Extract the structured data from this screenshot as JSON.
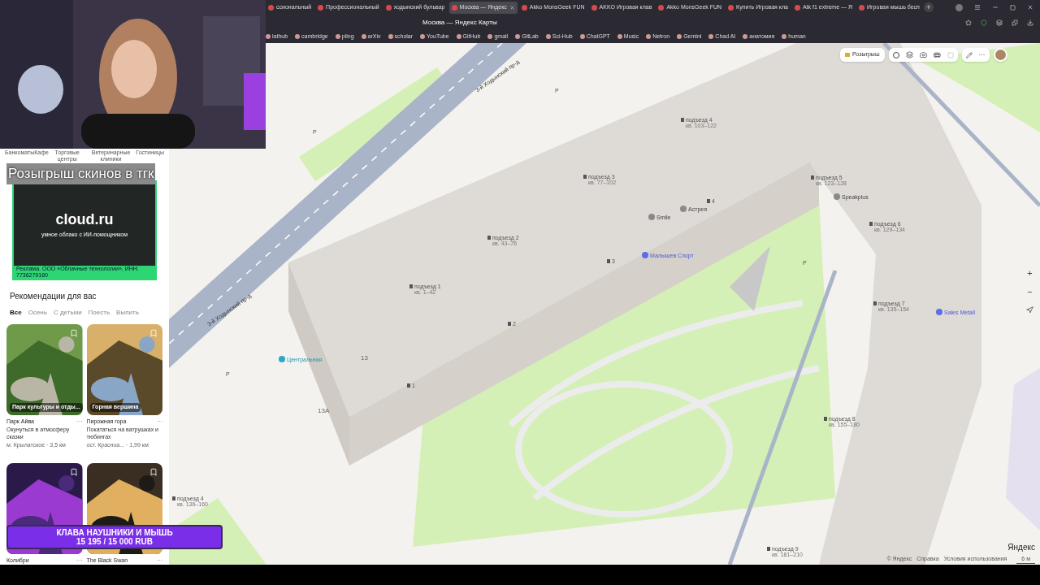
{
  "browser": {
    "tabs": [
      {
        "label": "ссиональный",
        "selected": false
      },
      {
        "label": "Профессиональный",
        "selected": false
      },
      {
        "label": "ходынский бульвар",
        "selected": false
      },
      {
        "label": "Москва — Яндекс",
        "selected": true
      },
      {
        "label": "Akko MonsGeek FUN",
        "selected": false
      },
      {
        "label": "AKKO Игровая клав",
        "selected": false
      },
      {
        "label": "Akko MonsGeek FUN",
        "selected": false
      },
      {
        "label": "Купить Игровая кла",
        "selected": false
      },
      {
        "label": "Atk f1 extreme — Я",
        "selected": false
      },
      {
        "label": "Игровая мышь бесп",
        "selected": false
      }
    ],
    "new_tab": "+",
    "page_title": "Москва — Яндекс Карты",
    "bookmarks": [
      "lathub",
      "cambridge",
      "pling",
      "arXiv",
      "scholar",
      "YouTube",
      "GitHub",
      "gmail",
      "GitLab",
      "Sci-Hub",
      "ChatGPT",
      "Music",
      "Netron",
      "Gemini",
      "Chad AI",
      "анатомия",
      "human"
    ]
  },
  "sidebar": {
    "categories": [
      "Банкоматы",
      "Кафе",
      "Торговые центры",
      "Ветеринарные клиники",
      "Гостиницы"
    ],
    "ad": {
      "brand": "cloud.ru",
      "tagline": "умное облако с ИИ-помощником",
      "disclaimer": "Реклама. ООО «Облачные технологии», ИНН: 7736279160"
    },
    "recommendations_title": "Рекомендации для вас",
    "filters": [
      {
        "label": "Все",
        "selected": true
      },
      {
        "label": "Осень",
        "selected": false
      },
      {
        "label": "С детьми",
        "selected": false
      },
      {
        "label": "Поесть",
        "selected": false
      },
      {
        "label": "Выпить",
        "selected": false
      }
    ],
    "cards": [
      {
        "caption": "Парк культуры и отды...",
        "title": "Парк Айва",
        "more": "···",
        "description": "Окунуться в атмосферу сказки",
        "meta": "м. Крылатское · 3,5 км"
      },
      {
        "caption": "Горная вершина",
        "title": "Пирожная гора",
        "more": "···",
        "description": "Покататься на ватрушках и тюбингах",
        "meta": "ост. Красноа... · 1,99 км"
      },
      {
        "title": "Колибри",
        "more": "···"
      },
      {
        "title": "The Black Swan",
        "more": "···"
      }
    ]
  },
  "map": {
    "labels": [
      {
        "kind": "street",
        "text": "3-й Ходынский пр-д"
      },
      {
        "kind": "street",
        "text": "3-й Ходынский пр-д"
      },
      {
        "kind": "entrance",
        "text": "подъезд 4",
        "sub": "кв. 103–122"
      },
      {
        "kind": "entrance",
        "text": "подъезд 3",
        "sub": "кв. 77–102"
      },
      {
        "kind": "entrance",
        "text": "подъезд 2",
        "sub": "кв. 43–76"
      },
      {
        "kind": "entrance",
        "text": "подъезд 1",
        "sub": "кв. 1–42"
      },
      {
        "kind": "entrance",
        "text": "подъезд 5",
        "sub": "кв. 123–128"
      },
      {
        "kind": "entrance",
        "text": "подъезд 6",
        "sub": "кв. 129–134"
      },
      {
        "kind": "entrance",
        "text": "подъезд 7",
        "sub": "кв. 135–154"
      },
      {
        "kind": "entrance",
        "text": "подъезд 8",
        "sub": "кв. 155–180"
      },
      {
        "kind": "entrance",
        "text": "подъезд 4",
        "sub": "кв. 136–160"
      },
      {
        "kind": "entrance",
        "text": "подъезд 9",
        "sub": "кв. 181–210"
      },
      {
        "kind": "poi",
        "text": "Smile"
      },
      {
        "kind": "poi",
        "text": "Астрея"
      },
      {
        "kind": "poi",
        "text": "Speakplus"
      },
      {
        "kind": "sport",
        "text": "Малышев Спорт"
      },
      {
        "kind": "sport",
        "text": "Sales Metall"
      },
      {
        "kind": "transit",
        "text": "Центральная"
      },
      {
        "kind": "number",
        "text": "13"
      },
      {
        "kind": "number",
        "text": "13А"
      },
      {
        "kind": "door",
        "text": "1"
      },
      {
        "kind": "door",
        "text": "2"
      },
      {
        "kind": "door",
        "text": "3"
      },
      {
        "kind": "door",
        "text": "4"
      },
      {
        "kind": "parking",
        "text": "P"
      },
      {
        "kind": "parking",
        "text": "P"
      },
      {
        "kind": "parking",
        "text": "P"
      },
      {
        "kind": "parking",
        "text": "P"
      }
    ],
    "promo_button": "Розыгрыш",
    "more": "···",
    "zoom_in": "+",
    "zoom_out": "−",
    "logo": "Яндекс",
    "footer": [
      "© Яндекс",
      "Справка",
      "Условия использования"
    ],
    "scale": "6 м"
  },
  "overlay": {
    "giveaway": "Розыгрыш скинов в тгк",
    "goal_title": "КЛАВА НАУШНИКИ И МЫШЬ",
    "goal_amount": "15 195 / 15 000 RUB"
  }
}
